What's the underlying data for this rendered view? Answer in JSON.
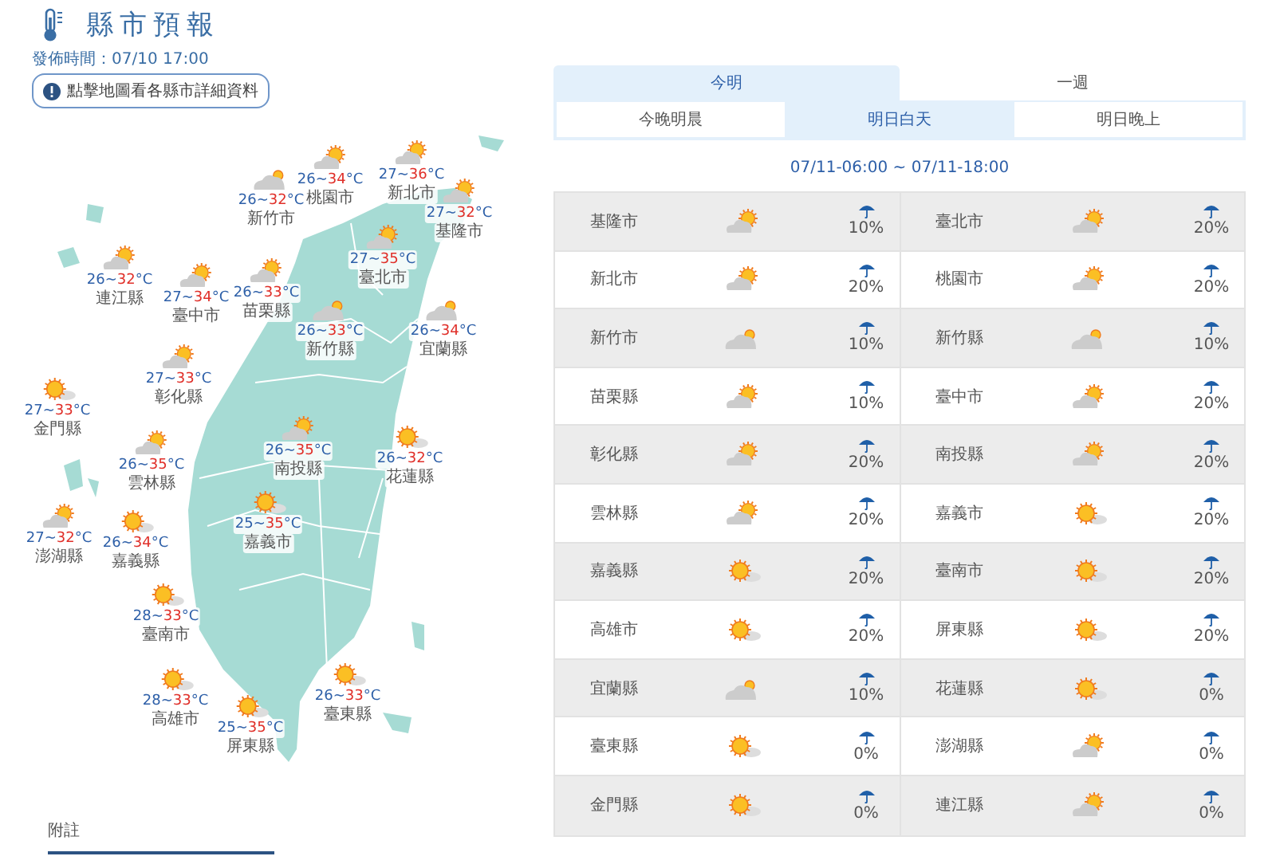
{
  "header": {
    "title": "縣市預報",
    "issued": "發佈時間：07/10 17:00",
    "notice": "點擊地圖看各縣市詳細資料"
  },
  "map": {
    "labels": [
      {
        "name": "桃園市",
        "low": "26~",
        "high": "34",
        "unit": "°C",
        "kind": "partly-cloudy"
      },
      {
        "name": "新北市",
        "low": "27~",
        "high": "36",
        "unit": "°C",
        "kind": "partly-cloudy"
      },
      {
        "name": "新竹市",
        "low": "26~",
        "high": "32",
        "unit": "°C",
        "kind": "mostly-cloudy"
      },
      {
        "name": "基隆市",
        "low": "27~",
        "high": "32",
        "unit": "°C",
        "kind": "partly-cloudy"
      },
      {
        "name": "臺北市",
        "low": "27~",
        "high": "35",
        "unit": "°C",
        "kind": "partly-cloudy"
      },
      {
        "name": "連江縣",
        "low": "26~",
        "high": "32",
        "unit": "°C",
        "kind": "partly-cloudy"
      },
      {
        "name": "臺中市",
        "low": "27~",
        "high": "34",
        "unit": "°C",
        "kind": "partly-cloudy"
      },
      {
        "name": "苗栗縣",
        "low": "26~",
        "high": "33",
        "unit": "°C",
        "kind": "partly-cloudy"
      },
      {
        "name": "新竹縣",
        "low": "26~",
        "high": "33",
        "unit": "°C",
        "kind": "mostly-cloudy"
      },
      {
        "name": "宜蘭縣",
        "low": "26~",
        "high": "34",
        "unit": "°C",
        "kind": "mostly-cloudy"
      },
      {
        "name": "彰化縣",
        "low": "27~",
        "high": "33",
        "unit": "°C",
        "kind": "partly-cloudy"
      },
      {
        "name": "金門縣",
        "low": "27~",
        "high": "33",
        "unit": "°C",
        "kind": "sunny"
      },
      {
        "name": "雲林縣",
        "low": "26~",
        "high": "35",
        "unit": "°C",
        "kind": "partly-cloudy"
      },
      {
        "name": "南投縣",
        "low": "26~",
        "high": "35",
        "unit": "°C",
        "kind": "partly-cloudy"
      },
      {
        "name": "花蓮縣",
        "low": "26~",
        "high": "32",
        "unit": "°C",
        "kind": "sunny"
      },
      {
        "name": "澎湖縣",
        "low": "27~",
        "high": "32",
        "unit": "°C",
        "kind": "partly-cloudy"
      },
      {
        "name": "嘉義縣",
        "low": "26~",
        "high": "34",
        "unit": "°C",
        "kind": "sunny"
      },
      {
        "name": "嘉義市",
        "low": "25~",
        "high": "35",
        "unit": "°C",
        "kind": "sunny"
      },
      {
        "name": "臺南市",
        "low": "28~",
        "high": "33",
        "unit": "°C",
        "kind": "sunny"
      },
      {
        "name": "高雄市",
        "low": "28~",
        "high": "33",
        "unit": "°C",
        "kind": "sunny"
      },
      {
        "name": "屏東縣",
        "low": "25~",
        "high": "35",
        "unit": "°C",
        "kind": "sunny"
      },
      {
        "name": "臺東縣",
        "low": "26~",
        "high": "33",
        "unit": "°C",
        "kind": "sunny"
      }
    ]
  },
  "notes_tab": "附註",
  "tabs": [
    {
      "label": "今明",
      "selected": true
    },
    {
      "label": "一週",
      "selected": false
    }
  ],
  "subtabs": [
    {
      "label": "今晚明晨",
      "selected": false
    },
    {
      "label": "明日白天",
      "selected": true
    },
    {
      "label": "明日晚上",
      "selected": false
    }
  ],
  "period": "07/11-06:00 ~ 07/11-18:00",
  "table": {
    "rows": [
      {
        "cells": [
          {
            "name": "基隆市",
            "kind": "partly-cloudy",
            "rain": "10%"
          },
          {
            "name": "臺北市",
            "kind": "partly-cloudy",
            "rain": "20%"
          }
        ]
      },
      {
        "cells": [
          {
            "name": "新北市",
            "kind": "partly-cloudy",
            "rain": "20%"
          },
          {
            "name": "桃園市",
            "kind": "partly-cloudy",
            "rain": "20%"
          }
        ]
      },
      {
        "cells": [
          {
            "name": "新竹市",
            "kind": "mostly-cloudy",
            "rain": "10%"
          },
          {
            "name": "新竹縣",
            "kind": "mostly-cloudy",
            "rain": "10%"
          }
        ]
      },
      {
        "cells": [
          {
            "name": "苗栗縣",
            "kind": "partly-cloudy",
            "rain": "10%"
          },
          {
            "name": "臺中市",
            "kind": "partly-cloudy",
            "rain": "20%"
          }
        ]
      },
      {
        "cells": [
          {
            "name": "彰化縣",
            "kind": "partly-cloudy",
            "rain": "20%"
          },
          {
            "name": "南投縣",
            "kind": "partly-cloudy",
            "rain": "20%"
          }
        ]
      },
      {
        "cells": [
          {
            "name": "雲林縣",
            "kind": "partly-cloudy",
            "rain": "20%"
          },
          {
            "name": "嘉義市",
            "kind": "sunny",
            "rain": "20%"
          }
        ]
      },
      {
        "cells": [
          {
            "name": "嘉義縣",
            "kind": "sunny",
            "rain": "20%"
          },
          {
            "name": "臺南市",
            "kind": "sunny",
            "rain": "20%"
          }
        ]
      },
      {
        "cells": [
          {
            "name": "高雄市",
            "kind": "sunny",
            "rain": "20%"
          },
          {
            "name": "屏東縣",
            "kind": "sunny",
            "rain": "20%"
          }
        ]
      },
      {
        "cells": [
          {
            "name": "宜蘭縣",
            "kind": "mostly-cloudy",
            "rain": "10%"
          },
          {
            "name": "花蓮縣",
            "kind": "sunny",
            "rain": "0%"
          }
        ]
      },
      {
        "cells": [
          {
            "name": "臺東縣",
            "kind": "sunny",
            "rain": "0%"
          },
          {
            "name": "澎湖縣",
            "kind": "partly-cloudy",
            "rain": "0%"
          }
        ]
      },
      {
        "cells": [
          {
            "name": "金門縣",
            "kind": "sunny",
            "rain": "0%"
          },
          {
            "name": "連江縣",
            "kind": "partly-cloudy",
            "rain": "0%"
          }
        ]
      }
    ]
  }
}
